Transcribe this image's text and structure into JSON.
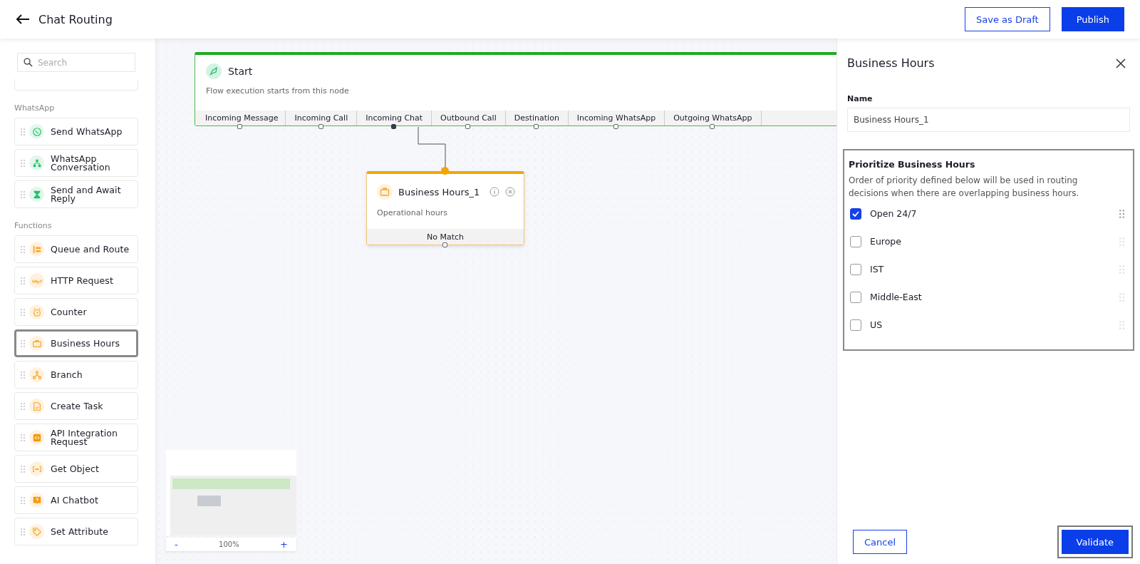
{
  "header": {
    "title": "Chat Routing",
    "buttons": [
      {
        "label": "Save as Draft",
        "kind": "outline"
      },
      {
        "label": "Publish",
        "kind": "primary"
      }
    ]
  },
  "sidebar": {
    "search": {
      "placeholder": "Search"
    },
    "sections": [
      {
        "title": "WhatsApp",
        "items": [
          {
            "label": "Send WhatsApp",
            "kind": "whatsapp",
            "highlighted": false
          },
          {
            "label": "WhatsApp Conversation",
            "kind": "tree",
            "highlighted": false
          },
          {
            "label": "Send and Await Reply",
            "kind": "hourglass",
            "highlighted": false
          }
        ]
      },
      {
        "title": "Functions",
        "items": [
          {
            "label": "Queue and Route",
            "kind": "queue",
            "highlighted": false
          },
          {
            "label": "HTTP Request",
            "kind": "http",
            "highlighted": false
          },
          {
            "label": "Counter",
            "kind": "timer",
            "highlighted": false
          },
          {
            "label": "Business Hours",
            "kind": "briefcase",
            "highlighted": true
          },
          {
            "label": "Branch",
            "kind": "branch",
            "highlighted": false
          },
          {
            "label": "Create Task",
            "kind": "task",
            "highlighted": false
          },
          {
            "label": "API Integration Request",
            "kind": "api",
            "highlighted": false
          },
          {
            "label": "Get Object",
            "kind": "object",
            "highlighted": false
          },
          {
            "label": "AI Chatbot",
            "kind": "chatbot",
            "highlighted": false
          },
          {
            "label": "Set Attribute",
            "kind": "tag",
            "highlighted": false
          }
        ]
      }
    ]
  },
  "canvas": {
    "start_node": {
      "title": "Start",
      "description": "Flow execution starts from this node",
      "outputs": [
        {
          "label": "Incoming Message",
          "connected": false
        },
        {
          "label": "Incoming Call",
          "connected": false
        },
        {
          "label": "Incoming Chat",
          "connected": true
        },
        {
          "label": "Outbound Call",
          "connected": false
        },
        {
          "label": "Destination",
          "connected": false
        },
        {
          "label": "Incoming WhatsApp",
          "connected": false
        },
        {
          "label": "Outgoing WhatsApp",
          "connected": false
        }
      ]
    },
    "business_node": {
      "title": "Business Hours_1",
      "description": "Operational hours",
      "output": "No Match"
    },
    "zoom": {
      "minus": "-",
      "level_text": "100%",
      "plus": "+"
    }
  },
  "panel": {
    "title": "Business Hours",
    "name_label": "Name",
    "name_value": "Business Hours_1",
    "priority_title": "Prioritize Business Hours",
    "priority_description": "Order of priority defined below will be used in routing decisions when there are overlapping business hours.",
    "options": [
      {
        "label": "Open 24/7",
        "checked": true
      },
      {
        "label": "Europe",
        "checked": false
      },
      {
        "label": "IST",
        "checked": false
      },
      {
        "label": "Middle-East",
        "checked": false
      },
      {
        "label": "US",
        "checked": false
      }
    ],
    "buttons": [
      {
        "label": "Cancel",
        "kind": "outline"
      },
      {
        "label": "Validate",
        "kind": "primary"
      }
    ]
  }
}
